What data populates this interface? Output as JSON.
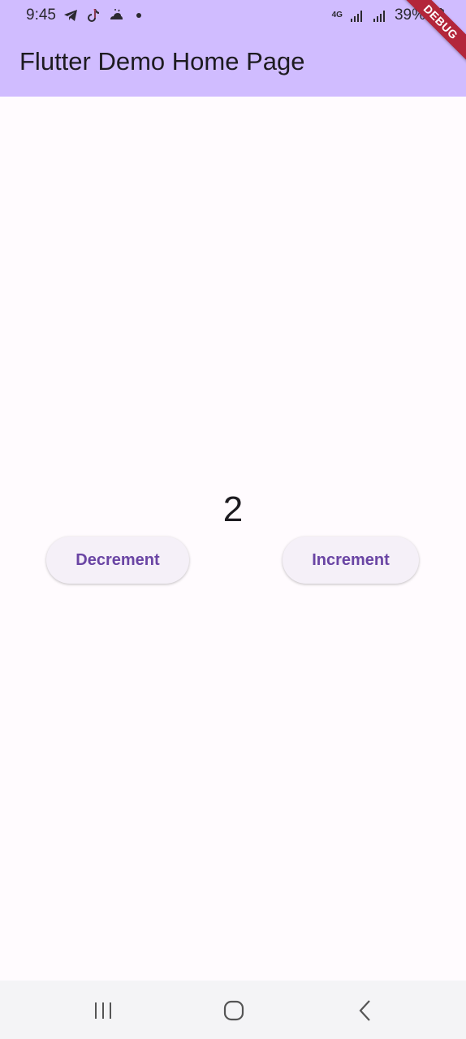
{
  "status_bar": {
    "time": "9:45",
    "network": "4G",
    "battery": "39%",
    "left_icons": [
      "telegram-icon",
      "tiktok-icon",
      "weather-icon",
      "dot-icon"
    ],
    "right_icons": [
      "signal-icon",
      "signal-icon",
      "battery-icon"
    ]
  },
  "app_bar": {
    "title": "Flutter Demo Home Page",
    "debug_label": "DEBUG"
  },
  "main": {
    "counter": "2",
    "decrement_label": "Decrement",
    "increment_label": "Increment"
  },
  "nav_bar": {
    "icons": [
      "recent-apps-icon",
      "home-icon",
      "back-icon"
    ]
  },
  "colors": {
    "app_bar": "#d0bcff",
    "background": "#fffbfe",
    "button_text": "#6a45a4",
    "button_bg": "#f5f0f8",
    "debug_banner": "#b3263a"
  }
}
